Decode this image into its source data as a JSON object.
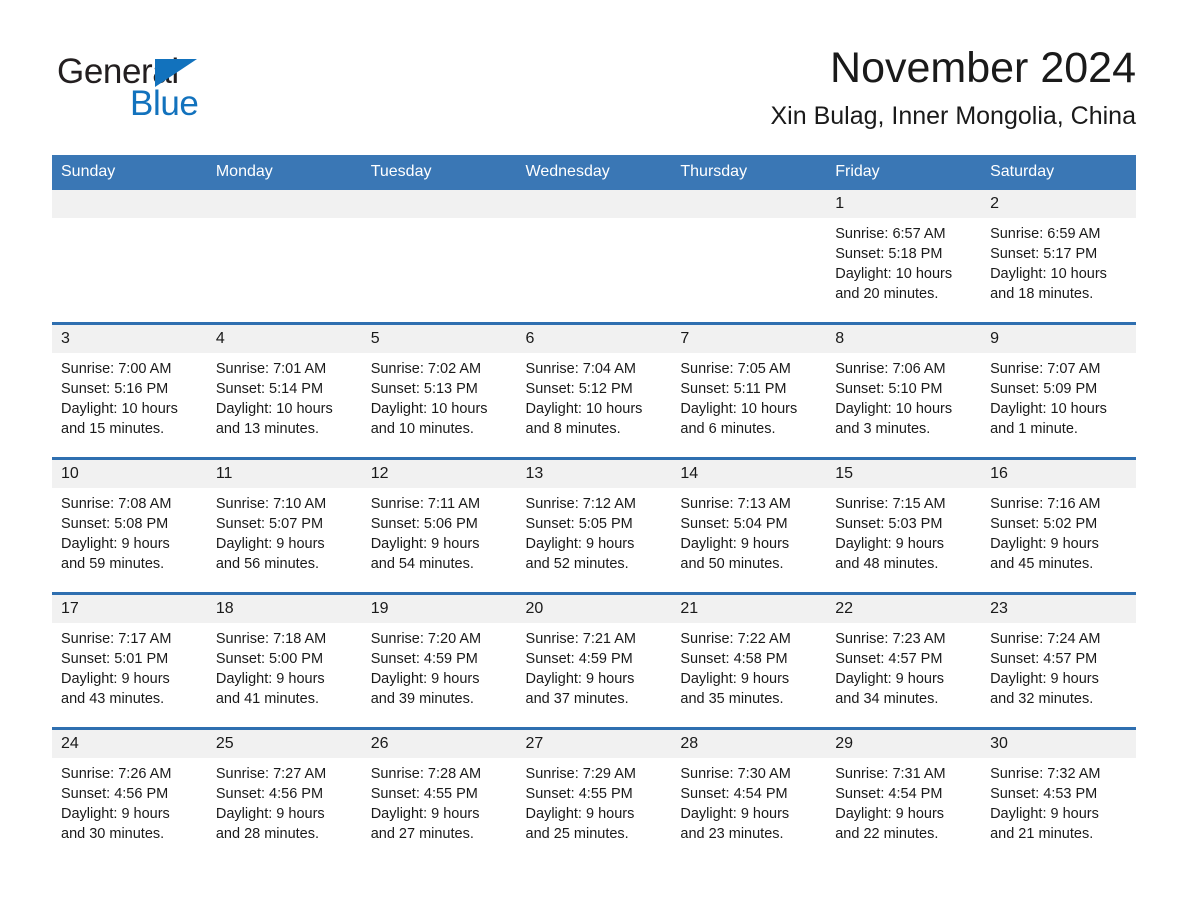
{
  "brand": {
    "name_part1": "General",
    "name_part2": "Blue",
    "triangle_color": "#1272BD"
  },
  "header": {
    "title": "November 2024",
    "subtitle": "Xin Bulag, Inner Mongolia, China"
  },
  "theme": {
    "header_row_bg": "#3A77B5",
    "row_divider": "#2F6FB0",
    "daynum_bg": "#F1F1F1",
    "text": "#1A1A1A"
  },
  "weekday_headers": [
    "Sunday",
    "Monday",
    "Tuesday",
    "Wednesday",
    "Thursday",
    "Friday",
    "Saturday"
  ],
  "weeks": [
    [
      {
        "day": "",
        "blank": true,
        "sunrise": "",
        "sunset": "",
        "daylight_line1": "",
        "daylight_line2": ""
      },
      {
        "day": "",
        "blank": true,
        "sunrise": "",
        "sunset": "",
        "daylight_line1": "",
        "daylight_line2": ""
      },
      {
        "day": "",
        "blank": true,
        "sunrise": "",
        "sunset": "",
        "daylight_line1": "",
        "daylight_line2": ""
      },
      {
        "day": "",
        "blank": true,
        "sunrise": "",
        "sunset": "",
        "daylight_line1": "",
        "daylight_line2": ""
      },
      {
        "day": "",
        "blank": true,
        "sunrise": "",
        "sunset": "",
        "daylight_line1": "",
        "daylight_line2": ""
      },
      {
        "day": "1",
        "blank": false,
        "sunrise": "Sunrise: 6:57 AM",
        "sunset": "Sunset: 5:18 PM",
        "daylight_line1": "Daylight: 10 hours",
        "daylight_line2": "and 20 minutes."
      },
      {
        "day": "2",
        "blank": false,
        "sunrise": "Sunrise: 6:59 AM",
        "sunset": "Sunset: 5:17 PM",
        "daylight_line1": "Daylight: 10 hours",
        "daylight_line2": "and 18 minutes."
      }
    ],
    [
      {
        "day": "3",
        "blank": false,
        "sunrise": "Sunrise: 7:00 AM",
        "sunset": "Sunset: 5:16 PM",
        "daylight_line1": "Daylight: 10 hours",
        "daylight_line2": "and 15 minutes."
      },
      {
        "day": "4",
        "blank": false,
        "sunrise": "Sunrise: 7:01 AM",
        "sunset": "Sunset: 5:14 PM",
        "daylight_line1": "Daylight: 10 hours",
        "daylight_line2": "and 13 minutes."
      },
      {
        "day": "5",
        "blank": false,
        "sunrise": "Sunrise: 7:02 AM",
        "sunset": "Sunset: 5:13 PM",
        "daylight_line1": "Daylight: 10 hours",
        "daylight_line2": "and 10 minutes."
      },
      {
        "day": "6",
        "blank": false,
        "sunrise": "Sunrise: 7:04 AM",
        "sunset": "Sunset: 5:12 PM",
        "daylight_line1": "Daylight: 10 hours",
        "daylight_line2": "and 8 minutes."
      },
      {
        "day": "7",
        "blank": false,
        "sunrise": "Sunrise: 7:05 AM",
        "sunset": "Sunset: 5:11 PM",
        "daylight_line1": "Daylight: 10 hours",
        "daylight_line2": "and 6 minutes."
      },
      {
        "day": "8",
        "blank": false,
        "sunrise": "Sunrise: 7:06 AM",
        "sunset": "Sunset: 5:10 PM",
        "daylight_line1": "Daylight: 10 hours",
        "daylight_line2": "and 3 minutes."
      },
      {
        "day": "9",
        "blank": false,
        "sunrise": "Sunrise: 7:07 AM",
        "sunset": "Sunset: 5:09 PM",
        "daylight_line1": "Daylight: 10 hours",
        "daylight_line2": "and 1 minute."
      }
    ],
    [
      {
        "day": "10",
        "blank": false,
        "sunrise": "Sunrise: 7:08 AM",
        "sunset": "Sunset: 5:08 PM",
        "daylight_line1": "Daylight: 9 hours",
        "daylight_line2": "and 59 minutes."
      },
      {
        "day": "11",
        "blank": false,
        "sunrise": "Sunrise: 7:10 AM",
        "sunset": "Sunset: 5:07 PM",
        "daylight_line1": "Daylight: 9 hours",
        "daylight_line2": "and 56 minutes."
      },
      {
        "day": "12",
        "blank": false,
        "sunrise": "Sunrise: 7:11 AM",
        "sunset": "Sunset: 5:06 PM",
        "daylight_line1": "Daylight: 9 hours",
        "daylight_line2": "and 54 minutes."
      },
      {
        "day": "13",
        "blank": false,
        "sunrise": "Sunrise: 7:12 AM",
        "sunset": "Sunset: 5:05 PM",
        "daylight_line1": "Daylight: 9 hours",
        "daylight_line2": "and 52 minutes."
      },
      {
        "day": "14",
        "blank": false,
        "sunrise": "Sunrise: 7:13 AM",
        "sunset": "Sunset: 5:04 PM",
        "daylight_line1": "Daylight: 9 hours",
        "daylight_line2": "and 50 minutes."
      },
      {
        "day": "15",
        "blank": false,
        "sunrise": "Sunrise: 7:15 AM",
        "sunset": "Sunset: 5:03 PM",
        "daylight_line1": "Daylight: 9 hours",
        "daylight_line2": "and 48 minutes."
      },
      {
        "day": "16",
        "blank": false,
        "sunrise": "Sunrise: 7:16 AM",
        "sunset": "Sunset: 5:02 PM",
        "daylight_line1": "Daylight: 9 hours",
        "daylight_line2": "and 45 minutes."
      }
    ],
    [
      {
        "day": "17",
        "blank": false,
        "sunrise": "Sunrise: 7:17 AM",
        "sunset": "Sunset: 5:01 PM",
        "daylight_line1": "Daylight: 9 hours",
        "daylight_line2": "and 43 minutes."
      },
      {
        "day": "18",
        "blank": false,
        "sunrise": "Sunrise: 7:18 AM",
        "sunset": "Sunset: 5:00 PM",
        "daylight_line1": "Daylight: 9 hours",
        "daylight_line2": "and 41 minutes."
      },
      {
        "day": "19",
        "blank": false,
        "sunrise": "Sunrise: 7:20 AM",
        "sunset": "Sunset: 4:59 PM",
        "daylight_line1": "Daylight: 9 hours",
        "daylight_line2": "and 39 minutes."
      },
      {
        "day": "20",
        "blank": false,
        "sunrise": "Sunrise: 7:21 AM",
        "sunset": "Sunset: 4:59 PM",
        "daylight_line1": "Daylight: 9 hours",
        "daylight_line2": "and 37 minutes."
      },
      {
        "day": "21",
        "blank": false,
        "sunrise": "Sunrise: 7:22 AM",
        "sunset": "Sunset: 4:58 PM",
        "daylight_line1": "Daylight: 9 hours",
        "daylight_line2": "and 35 minutes."
      },
      {
        "day": "22",
        "blank": false,
        "sunrise": "Sunrise: 7:23 AM",
        "sunset": "Sunset: 4:57 PM",
        "daylight_line1": "Daylight: 9 hours",
        "daylight_line2": "and 34 minutes."
      },
      {
        "day": "23",
        "blank": false,
        "sunrise": "Sunrise: 7:24 AM",
        "sunset": "Sunset: 4:57 PM",
        "daylight_line1": "Daylight: 9 hours",
        "daylight_line2": "and 32 minutes."
      }
    ],
    [
      {
        "day": "24",
        "blank": false,
        "sunrise": "Sunrise: 7:26 AM",
        "sunset": "Sunset: 4:56 PM",
        "daylight_line1": "Daylight: 9 hours",
        "daylight_line2": "and 30 minutes."
      },
      {
        "day": "25",
        "blank": false,
        "sunrise": "Sunrise: 7:27 AM",
        "sunset": "Sunset: 4:56 PM",
        "daylight_line1": "Daylight: 9 hours",
        "daylight_line2": "and 28 minutes."
      },
      {
        "day": "26",
        "blank": false,
        "sunrise": "Sunrise: 7:28 AM",
        "sunset": "Sunset: 4:55 PM",
        "daylight_line1": "Daylight: 9 hours",
        "daylight_line2": "and 27 minutes."
      },
      {
        "day": "27",
        "blank": false,
        "sunrise": "Sunrise: 7:29 AM",
        "sunset": "Sunset: 4:55 PM",
        "daylight_line1": "Daylight: 9 hours",
        "daylight_line2": "and 25 minutes."
      },
      {
        "day": "28",
        "blank": false,
        "sunrise": "Sunrise: 7:30 AM",
        "sunset": "Sunset: 4:54 PM",
        "daylight_line1": "Daylight: 9 hours",
        "daylight_line2": "and 23 minutes."
      },
      {
        "day": "29",
        "blank": false,
        "sunrise": "Sunrise: 7:31 AM",
        "sunset": "Sunset: 4:54 PM",
        "daylight_line1": "Daylight: 9 hours",
        "daylight_line2": "and 22 minutes."
      },
      {
        "day": "30",
        "blank": false,
        "sunrise": "Sunrise: 7:32 AM",
        "sunset": "Sunset: 4:53 PM",
        "daylight_line1": "Daylight: 9 hours",
        "daylight_line2": "and 21 minutes."
      }
    ]
  ]
}
